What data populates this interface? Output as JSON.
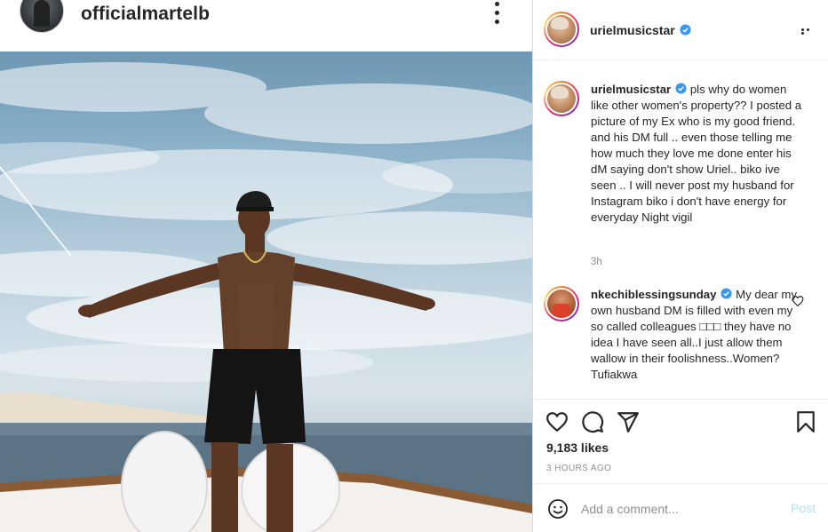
{
  "embedded_post": {
    "username": "officialmartelb"
  },
  "post": {
    "author": {
      "username": "urielmusicstar",
      "verified": true
    },
    "caption": {
      "username": "urielmusicstar",
      "text": "pls why do women like other women's property?? I posted a picture of my Ex who is my good friend. and his DM full .. even those telling me how much they love me done enter his dM saying don't show Uriel.. biko ive seen .. I will never post my husband for Instagram biko i don't have energy for everyday Night vigil",
      "time": "3h"
    },
    "comments": [
      {
        "username": "nkechiblessingsunday",
        "verified": true,
        "text": "My dear my own husband DM is filled with even my so called colleagues □□□ they have no idea I have seen all..I just allow them wallow in their foolishness..Women? Tufiakwa"
      }
    ],
    "likes": "9,183 likes",
    "time_ago": "3 HOURS AGO",
    "comment_box": {
      "placeholder": "Add a comment...",
      "post_label": "Post"
    }
  },
  "icons": {
    "more": "more-options-icon",
    "verified": "verified-badge-icon",
    "like": "heart-icon",
    "comment": "comment-icon",
    "share": "share-icon",
    "save": "bookmark-icon",
    "emoji": "emoji-icon"
  },
  "colors": {
    "text": "#262626",
    "muted": "#8e8e8e",
    "verified": "#3897f0",
    "post_button": "#b2dffc",
    "divider": "#dbdbdb"
  }
}
